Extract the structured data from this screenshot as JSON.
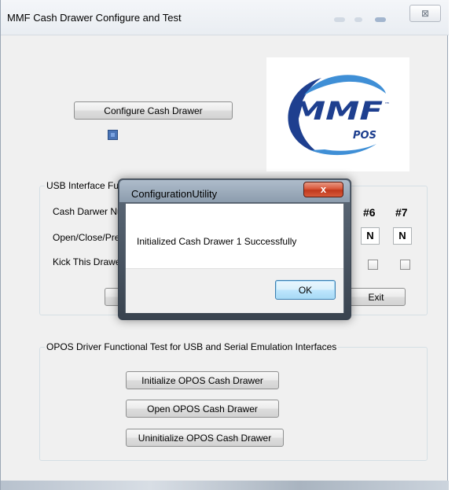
{
  "window": {
    "title": "MMF Cash Drawer Configure and Test",
    "close_glyph": "⊠"
  },
  "configure_button": "Configure Cash Drawer",
  "logo": {
    "wordmark": "MMF",
    "sub": "POS",
    "tm": "™",
    "primary_color": "#1e3f8f",
    "swoosh_color": "#3f8fd6"
  },
  "usb_group": {
    "legend": "USB Interface Fu",
    "row_labels": {
      "drawer_number": "Cash Darwer Nu",
      "open_close": "Open/Close/Pre",
      "kick": "Kick This Drawer"
    },
    "drawer_headers": [
      "#6",
      "#7"
    ],
    "drawer_status": [
      "N",
      "N"
    ],
    "hidden_button_fragment": "S",
    "exit_button": "Exit"
  },
  "opos_group": {
    "legend": "OPOS Driver Functional Test for USB and Serial Emulation Interfaces",
    "buttons": {
      "initialize": "Initialize OPOS Cash Drawer",
      "open": "Open OPOS Cash Drawer",
      "uninitialize": "Uninitialize OPOS Cash Drawer"
    }
  },
  "dialog": {
    "title": "ConfigurationUtility",
    "close_glyph": "x",
    "message": "Initialized Cash Drawer 1 Successfully",
    "ok_button": "OK"
  }
}
